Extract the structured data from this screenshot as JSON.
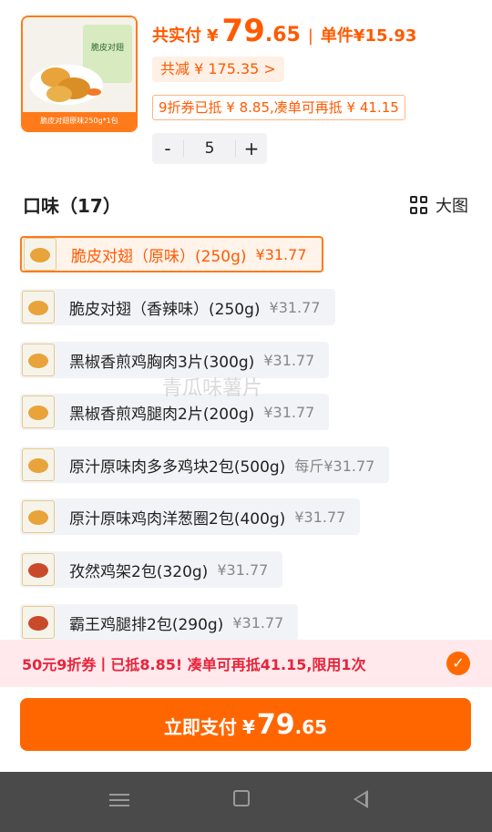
{
  "product": {
    "thumb_caption": "脆皮对翅原味250g*1包",
    "thumb_brand_text": "脆皮对翅"
  },
  "price": {
    "total_label": "共实付",
    "currency": "¥",
    "total_int": "79",
    "total_dec": ".65",
    "unit_label": "单件",
    "unit_price": "¥15.93"
  },
  "discount": {
    "label": "共减 ¥ 175.35 >"
  },
  "coupon_tag": "9折券已抵 ¥ 8.85,凑单可再抵 ¥ 41.15",
  "stepper": {
    "minus": "-",
    "value": "5",
    "plus": "+"
  },
  "flavors": {
    "title": "口味（17）",
    "big_view_label": "大图",
    "options": [
      {
        "name": "脆皮对翅（原味）(250g)",
        "price": "¥31.77",
        "selected": true
      },
      {
        "name": "脆皮对翅（香辣味）(250g)",
        "price": "¥31.77"
      },
      {
        "name": "黑椒香煎鸡胸肉3片(300g)",
        "price": "¥31.77"
      },
      {
        "name": "黑椒香煎鸡腿肉2片(200g)",
        "price": "¥31.77"
      },
      {
        "name": "原汁原味肉多多鸡块2包(500g)",
        "price": "每斤¥31.77"
      },
      {
        "name": "原汁原味鸡肉洋葱圈2包(400g)",
        "price": "¥31.77"
      },
      {
        "name": "孜然鸡架2包(320g)",
        "price": "¥31.77"
      },
      {
        "name": "霸王鸡腿排2包(290g)",
        "price": "¥31.77"
      }
    ]
  },
  "watermark": "青瓜味薯片",
  "coupon_bar": {
    "text": "50元9折券丨已抵8.85! 凑单可再抵41.15,限用1次"
  },
  "pay_button": {
    "label": "立即支付",
    "currency": "¥",
    "int": "79",
    "dec": ".65"
  },
  "colors": {
    "accent": "#ff6600",
    "coupon_bg": "#ffe9ec",
    "coupon_text": "#e8233a"
  }
}
